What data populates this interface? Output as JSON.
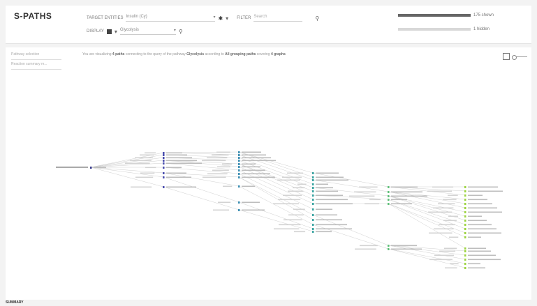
{
  "app": {
    "title": "S-PATHS"
  },
  "controls": {
    "row1_label": "TARGET ENTITIES",
    "target_select": "Insulin (Cy)",
    "filter_label": "FILTER",
    "filter_placeholder": "Search",
    "row2_label": "DISPLAY",
    "display_select": "Glycolysis"
  },
  "stats": [
    {
      "label": "175 shown",
      "fraction": 1.0,
      "color": "#666666"
    },
    {
      "label": "1 hidden",
      "fraction": 1.0,
      "color": "#d8d8d8"
    }
  ],
  "sidebar": [
    {
      "label": "Pathway selection"
    },
    {
      "label": "Reaction summary m..."
    }
  ],
  "info": {
    "prefix": "You are visualizing",
    "entity_count": "4 paths",
    "mid1": "connecting to the query of the pathway",
    "query": "Glycolysis",
    "mid2": "according to",
    "scope": "All grouping paths",
    "mid3": "covering",
    "species": "4 graphs"
  },
  "footer": {
    "label": "SUMMARY"
  },
  "icons": {
    "settings": "gear-icon",
    "filter_go": "search-icon",
    "display_go": "search-icon",
    "view_box": "square-icon"
  }
}
